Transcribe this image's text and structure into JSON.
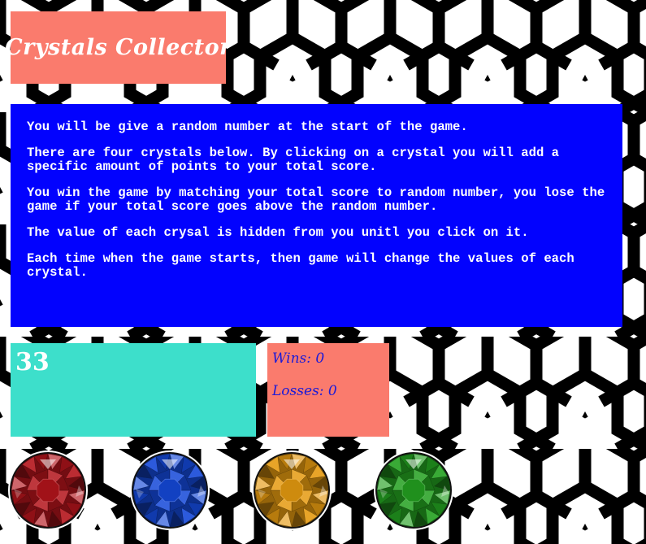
{
  "game": {
    "title": "Crystals Collector",
    "instructions": [
      "You will be give a random number at the start of the game.",
      "There are four crystals below. By clicking on a crystal you will add a specific amount of points to your total score.",
      "You win the game by matching your total score to random number, you lose the game if your total score goes above the random number.",
      "The value of each crysal is hidden from you unitl you click on it.",
      "Each time when the game starts, then game will change the values of each crystal."
    ],
    "target_number": "33",
    "wins_text": "Wins: 0",
    "losses_text": "Losses: 0"
  },
  "crystals": [
    {
      "name": "red-crystal",
      "color": "#b3141b"
    },
    {
      "name": "blue-crystal",
      "color": "#1448d8"
    },
    {
      "name": "yellow-crystal",
      "color": "#e59a10"
    },
    {
      "name": "green-crystal",
      "color": "#23a020"
    }
  ],
  "colors": {
    "title_bg": "#fa7b6d",
    "instructions_bg": "#0202fe",
    "target_bg": "#3ddfcb",
    "score_bg": "#fa7b6d",
    "score_text": "#1a1ad8"
  }
}
